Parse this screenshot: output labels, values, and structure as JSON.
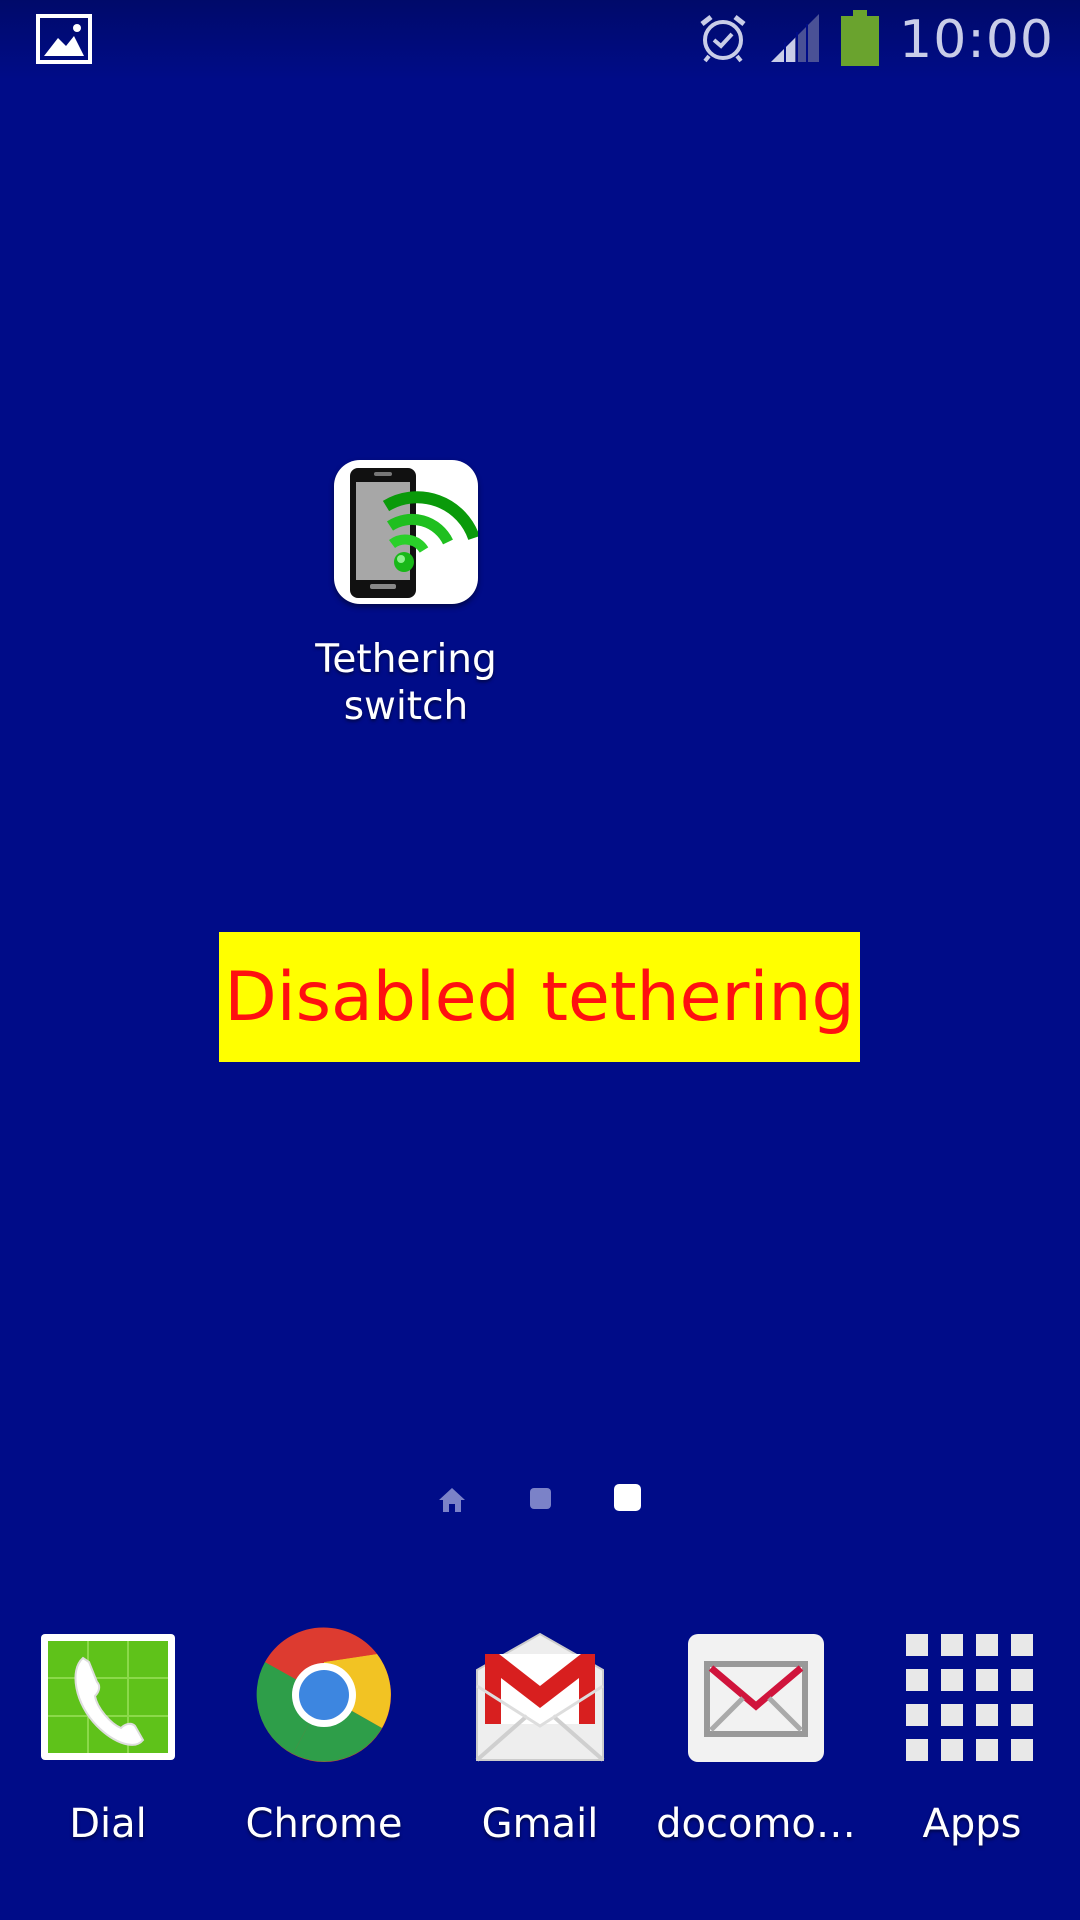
{
  "status_bar": {
    "time": "10:00",
    "icons": [
      "gallery-icon",
      "alarm-icon",
      "signal-icon",
      "battery-icon"
    ],
    "battery_color": "#6aa32e"
  },
  "desktop": {
    "shortcut": {
      "label": "Tethering\nswitch",
      "icon": "tethering-switch-icon"
    },
    "banner": {
      "text": "Disabled tethering",
      "background": "#ffff00",
      "text_color": "#ff1010"
    }
  },
  "page_indicator": {
    "pages": 3,
    "active_page": 3
  },
  "dock": {
    "items": [
      {
        "label": "Dial",
        "icon": "phone-icon"
      },
      {
        "label": "Chrome",
        "icon": "chrome-icon"
      },
      {
        "label": "Gmail",
        "icon": "gmail-icon"
      },
      {
        "label": "docomo…",
        "icon": "email-icon"
      },
      {
        "label": "Apps",
        "icon": "apps-grid-icon"
      }
    ]
  },
  "colors": {
    "wallpaper": "#000c88"
  }
}
